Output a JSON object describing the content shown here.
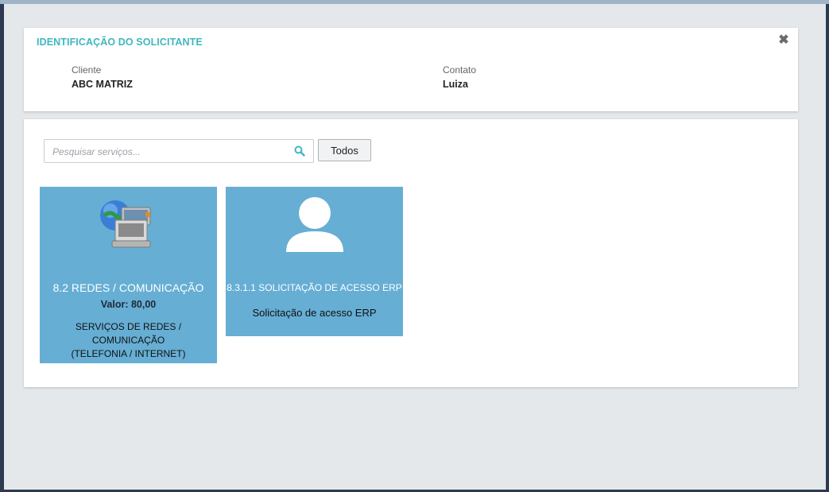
{
  "identification": {
    "title": "IDENTIFICAÇÃO DO SOLICITANTE",
    "close_icon": "close-icon",
    "client_label": "Cliente",
    "client_value": "ABC MATRIZ",
    "contact_label": "Contato",
    "contact_value": "Luiza"
  },
  "search": {
    "placeholder": "Pesquisar serviços...",
    "value": "",
    "icon": "search-icon",
    "filter_button": "Todos"
  },
  "services": [
    {
      "icon": "network-computers-icon",
      "name": "8.2 REDES / COMUNICAÇÃO",
      "price": "Valor: 80,00",
      "description_line1": "SERVIÇOS DE REDES / COMUNICAÇÃO",
      "description_line2": "(TELEFONIA / INTERNET)"
    },
    {
      "icon": "user-icon",
      "name": "8.3.1.1 SOLICITAÇÃO DE ACESSO ERP",
      "description": "Solicitação de acesso ERP"
    }
  ],
  "colors": {
    "accent": "#3fb7be",
    "tile_background": "#66aed4",
    "page_background": "#e5e8eb"
  }
}
